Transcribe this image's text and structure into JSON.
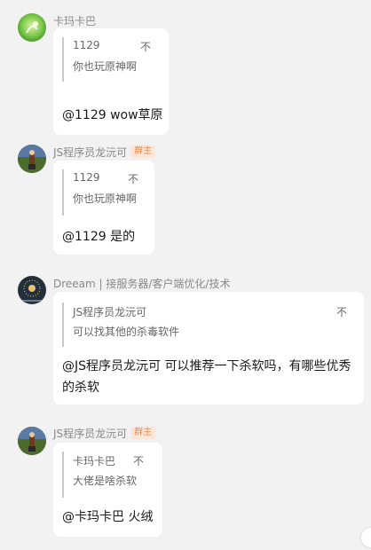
{
  "messages": [
    {
      "sender": "卡玛卡巴",
      "badge": "",
      "quote": {
        "name": "1129",
        "tag": "不",
        "text": "你也玩原神啊"
      },
      "reply": "@1129 wow草原"
    },
    {
      "sender": "JS程序员龙沅可",
      "badge": "群主",
      "quote": {
        "name": "1129",
        "tag": "不",
        "text": "你也玩原神啊"
      },
      "reply": "@1129 是的"
    },
    {
      "sender": "Dreeam | 接服务器/客户端优化/技术",
      "badge": "",
      "quote": {
        "name": "JS程序员龙沅可",
        "tag": "不",
        "text": "可以找其他的杀毒软件"
      },
      "reply_line1": "@JS程序员龙沅可 可以推荐一下杀软吗，有哪些优秀",
      "reply_line2": "的杀软"
    },
    {
      "sender": "JS程序员龙沅可",
      "badge": "群主",
      "quote": {
        "name": "卡玛卡巴",
        "tag": "不",
        "text": "大佬是啥杀软"
      },
      "reply": "@卡玛卡巴 火绒"
    }
  ],
  "colors": {
    "background": "#f2f2f2",
    "bubble": "#ffffff",
    "badge_bg": "#fde6d6",
    "badge_text": "#f08a4b",
    "sender": "#888888"
  },
  "icons": [
    "avatar-green-anime",
    "avatar-landscape",
    "avatar-firework-dark",
    "avatar-landscape"
  ]
}
